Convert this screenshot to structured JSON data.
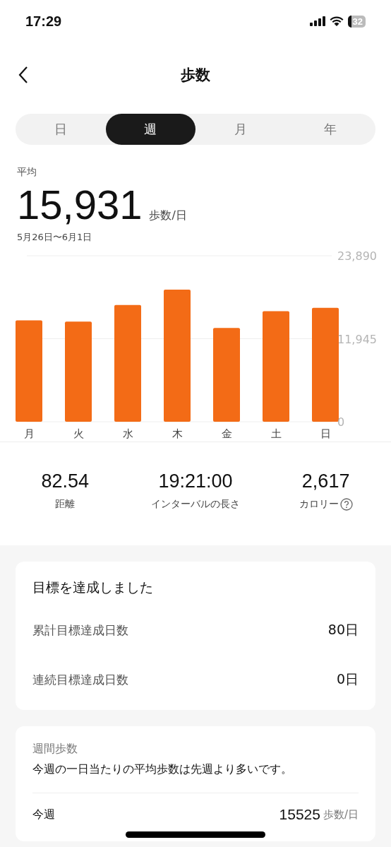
{
  "status_bar": {
    "time": "17:29",
    "battery": "32"
  },
  "nav": {
    "title": "歩数"
  },
  "tabs": [
    {
      "label": "日",
      "selected": false
    },
    {
      "label": "週",
      "selected": true
    },
    {
      "label": "月",
      "selected": false
    },
    {
      "label": "年",
      "selected": false
    }
  ],
  "summary": {
    "label": "平均",
    "value": "15,931",
    "unit": "歩数/日",
    "range": "5月26日〜6月1日"
  },
  "chart_data": {
    "type": "bar",
    "categories": [
      "月",
      "火",
      "水",
      "木",
      "金",
      "土",
      "日"
    ],
    "series": [
      {
        "color": "#f36b16",
        "values": [
          14600,
          14400,
          16800,
          19000,
          13500,
          15900,
          16400
        ]
      }
    ],
    "ylim": [
      0,
      23890
    ],
    "yticks": [
      {
        "value": 0,
        "label": "0"
      },
      {
        "value": 11945,
        "label": "11,945"
      },
      {
        "value": 23890,
        "label": "23,890"
      }
    ]
  },
  "stats": [
    {
      "value": "82.54",
      "label": "距離",
      "help": false
    },
    {
      "value": "19:21:00",
      "label": "インターバルの長さ",
      "help": false
    },
    {
      "value": "2,617",
      "label": "カロリー",
      "help": true
    }
  ],
  "goal_card": {
    "title": "目標を達成しました",
    "rows": [
      {
        "label": "累計目標達成日数",
        "value": "80日"
      },
      {
        "label": "連続目標達成日数",
        "value": "0日"
      }
    ]
  },
  "weekly_card": {
    "title": "週間歩数",
    "message": "今週の一日当たりの平均歩数は先週より多いです。",
    "rows": [
      {
        "label": "今週",
        "value": "15525",
        "unit": "歩数/日"
      }
    ]
  }
}
